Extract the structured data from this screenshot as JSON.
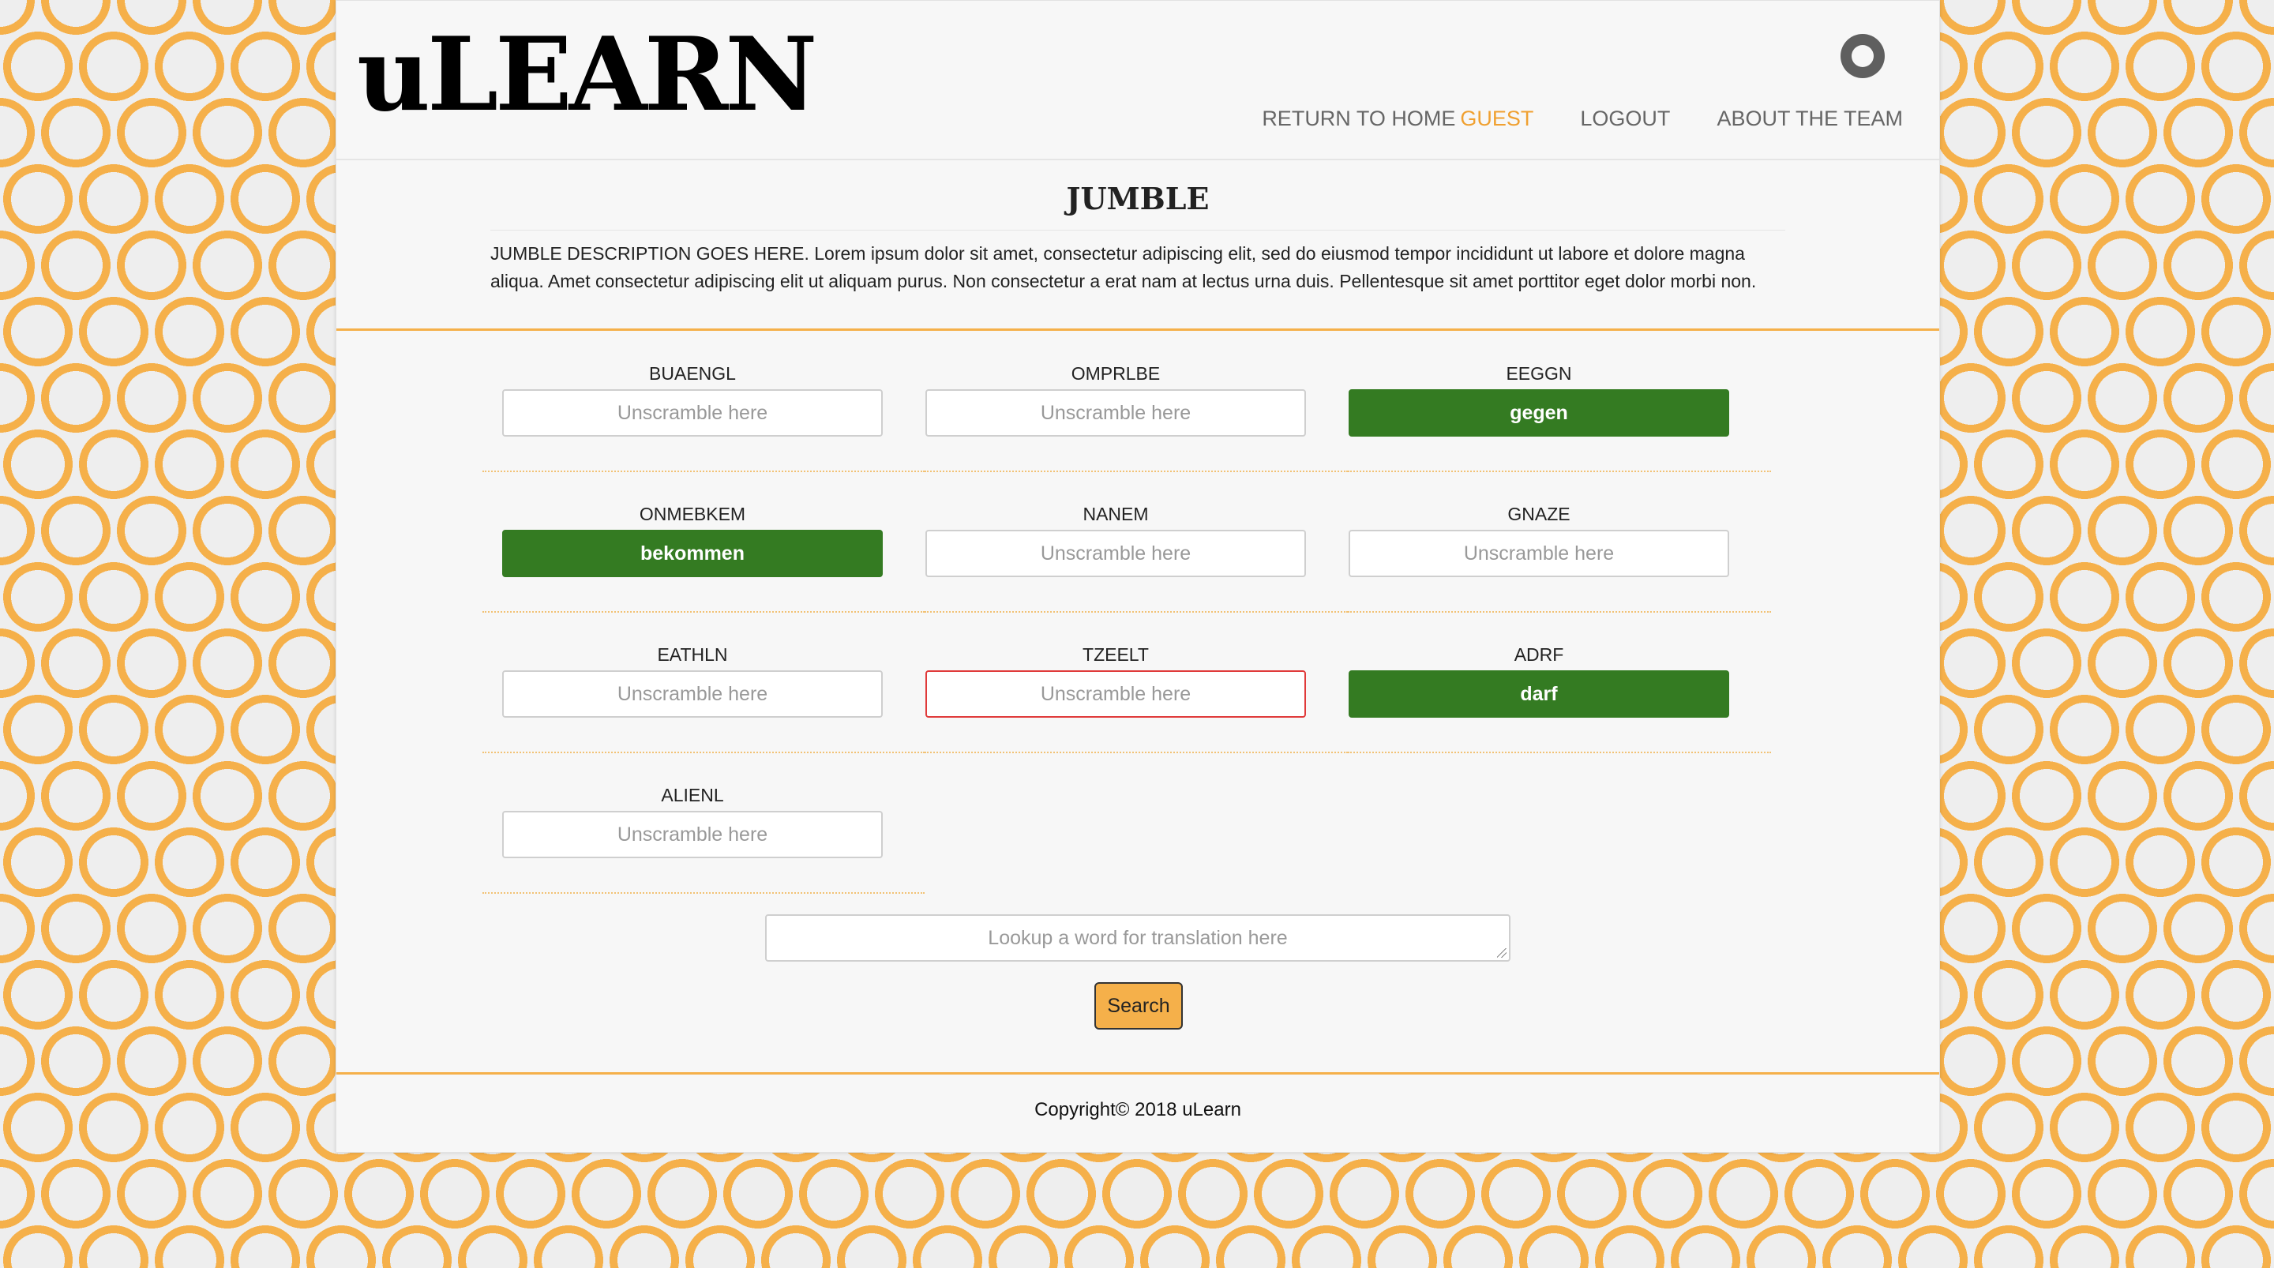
{
  "header": {
    "logo": "uLEARN",
    "nav": {
      "return_home": "RETURN TO HOME",
      "username": "GUEST",
      "logout": "LOGOUT",
      "about": "ABOUT THE TEAM"
    }
  },
  "page": {
    "title": "JUMBLE",
    "description": "JUMBLE DESCRIPTION GOES HERE. Lorem ipsum dolor sit amet, consectetur adipiscing elit, sed do eiusmod tempor incididunt ut labore et dolore magna aliqua. Amet consectetur adipiscing elit ut aliquam purus. Non consectetur a erat nam at lectus urna duis. Pellentesque sit amet porttitor eget dolor morbi non."
  },
  "jumble": {
    "placeholder": "Unscramble here",
    "rows": [
      [
        {
          "scrambled": "BUAENGL",
          "answer": "",
          "state": "empty"
        },
        {
          "scrambled": "OMPRLBE",
          "answer": "",
          "state": "empty"
        },
        {
          "scrambled": "EEGGN",
          "answer": "gegen",
          "state": "correct"
        }
      ],
      [
        {
          "scrambled": "ONMEBKEM",
          "answer": "bekommen",
          "state": "correct"
        },
        {
          "scrambled": "NANEM",
          "answer": "",
          "state": "empty"
        },
        {
          "scrambled": "GNAZE",
          "answer": "",
          "state": "empty"
        }
      ],
      [
        {
          "scrambled": "EATHLN",
          "answer": "",
          "state": "empty"
        },
        {
          "scrambled": "TZEELT",
          "answer": "",
          "state": "error"
        },
        {
          "scrambled": "ADRF",
          "answer": "darf",
          "state": "correct"
        }
      ],
      [
        {
          "scrambled": "ALIENL",
          "answer": "",
          "state": "empty"
        }
      ]
    ]
  },
  "lookup": {
    "placeholder": "Lookup a word for translation here",
    "button_label": "Search"
  },
  "footer": {
    "copyright": "Copyright© 2018 uLearn"
  },
  "colors": {
    "accent": "#f5b04a",
    "correct": "#347b22",
    "error": "#e03a3a"
  }
}
